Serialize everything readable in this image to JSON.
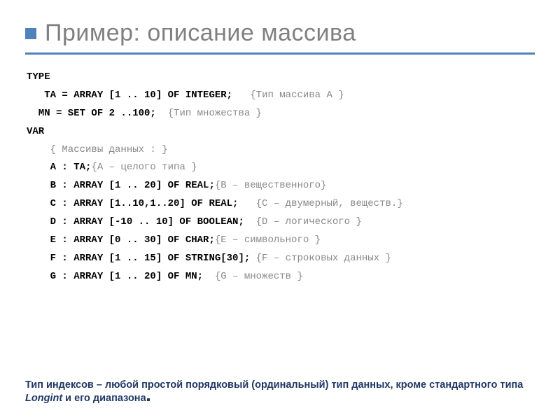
{
  "title": "Пример: описание массива",
  "code": {
    "l1": "TYPE",
    "l2a": "   TA = ARRAY [1 .. 10] OF INTEGER;   ",
    "l2b": "{Тип массива A }",
    "l3a": "  MN = SET OF 2 ..100;  ",
    "l3b": "{Тип множества }",
    "l4": "VAR",
    "l5": "    { Массивы данных : }",
    "l6a": "    A : TA;",
    "l6b": "{A – целого типа }",
    "l7a": "    B : ARRAY [1 .. 20] OF REAL;",
    "l7b": "{B – вещественного}",
    "l8a": "    C : ARRAY [1..10,1..20] OF REAL;   ",
    "l8b": "{C – двумерный, веществ.}",
    "l9a": "    D : ARRAY [-10 .. 10] OF BOOLEAN;  ",
    "l9b": "{D – логического }",
    "l10a": "    E : ARRAY [0 .. 30] OF CHAR;",
    "l10b": "{E – символьного }",
    "l11a": "    F : ARRAY [1 .. 15] OF STRING[30]; ",
    "l11b": "{F – строковых данных }",
    "l12a": "    G : ARRAY [1 .. 20] OF MN;  ",
    "l12b": "{G – множеств }"
  },
  "note": {
    "part1": "Тип индексов – любой простой порядковый (ординальный) тип данных, кроме стандартного типа ",
    "em": "Longint",
    "part2": " и его диапазона"
  }
}
